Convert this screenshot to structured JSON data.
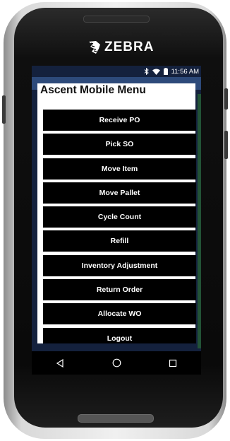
{
  "device": {
    "brand": "ZEBRA"
  },
  "status_bar": {
    "time": "11:56 AM",
    "icons": [
      "bluetooth-icon",
      "wifi-icon",
      "battery-icon"
    ]
  },
  "dialog": {
    "title": "Ascent Mobile Menu",
    "items": [
      {
        "label": "Receive PO"
      },
      {
        "label": "Pick SO"
      },
      {
        "label": "Move Item"
      },
      {
        "label": "Move Pallet"
      },
      {
        "label": "Cycle Count"
      },
      {
        "label": "Refill"
      },
      {
        "label": "Inventory Adjustment"
      },
      {
        "label": "Return Order"
      },
      {
        "label": "Allocate WO"
      },
      {
        "label": "Logout"
      }
    ]
  },
  "nav_bar": {
    "icons": [
      "back-icon",
      "home-icon",
      "recents-icon"
    ]
  },
  "colors": {
    "screen_bg": "#14213d",
    "menu_item_bg": "#000000",
    "menu_item_text": "#ffffff",
    "dialog_bg": "#ffffff"
  }
}
